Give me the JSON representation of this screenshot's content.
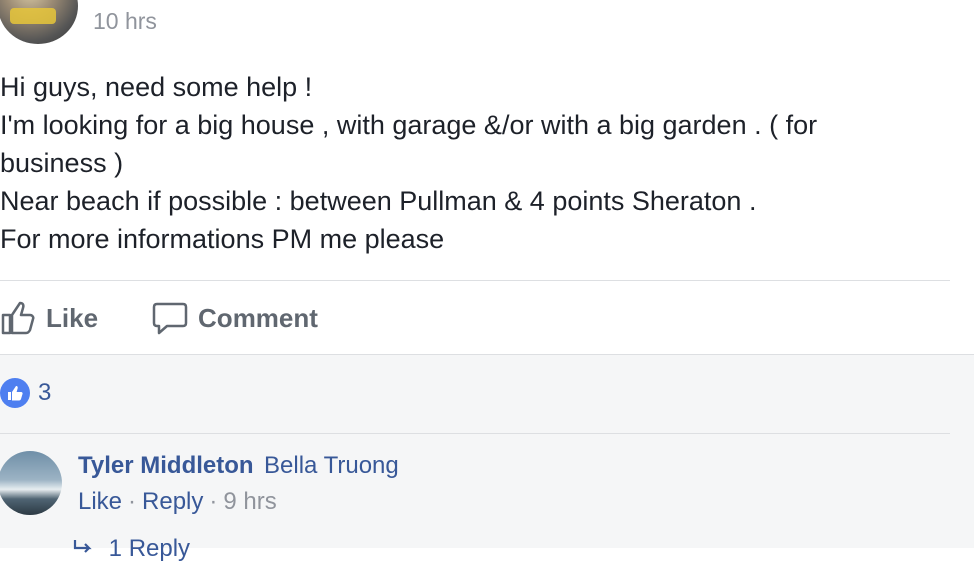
{
  "post": {
    "timestamp": "10 hrs",
    "lines": [
      "Hi guys, need some help !",
      "I'm looking for a big house , with garage &/or with a big garden . ( for",
      "business )",
      "Near beach if possible : between Pullman & 4 points Sheraton .",
      "For more informations PM me please"
    ],
    "actions": {
      "like_label": "Like",
      "comment_label": "Comment"
    },
    "reactions": {
      "count": "3"
    }
  },
  "comment": {
    "author": "Tyler Middleton",
    "text": "Bella Truong",
    "like_label": "Like",
    "reply_label": "Reply",
    "time": "9 hrs",
    "replies_label": "1 Reply"
  },
  "icons": {
    "like": "thumbs-up-icon",
    "comment": "speech-bubble-icon",
    "reaction": "like-reaction-icon",
    "reply_arrow": "reply-arrow-icon"
  },
  "colors": {
    "link": "#385898",
    "muted": "#90949c",
    "text": "#1d2129",
    "like_badge": "#4e7ff0",
    "comments_bg": "#f5f6f7"
  }
}
